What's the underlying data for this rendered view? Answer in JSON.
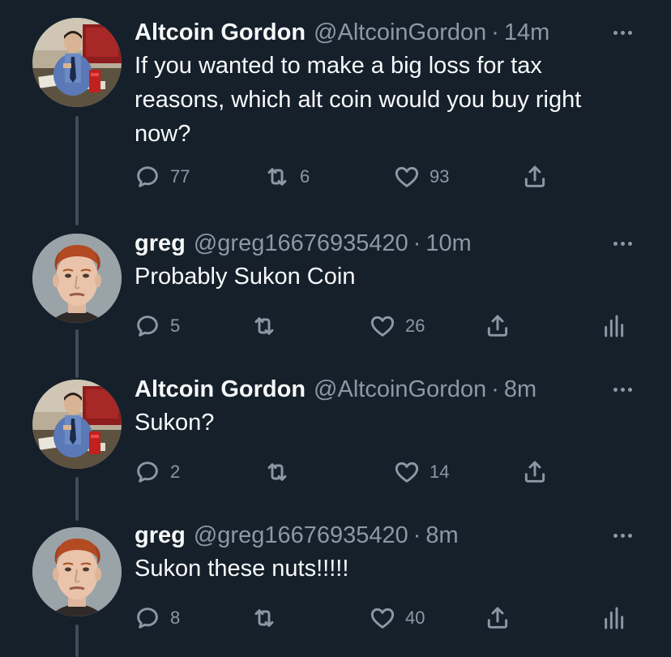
{
  "tweets": [
    {
      "author": "Altcoin Gordon",
      "handle": "@AltcoinGordon",
      "separator": "·",
      "time": "14m",
      "text": "If you wanted to make a big loss for tax reasons, which alt coin would you buy right now?",
      "replies": "77",
      "retweets": "6",
      "likes": "93",
      "avatar": "man-at-desk-avatar"
    },
    {
      "author": "greg",
      "handle": "@greg16676935420",
      "separator": "·",
      "time": "10m",
      "text": "Probably Sukon Coin",
      "replies": "5",
      "retweets": "",
      "likes": "26",
      "avatar": "red-haired-man-avatar"
    },
    {
      "author": "Altcoin Gordon",
      "handle": "@AltcoinGordon",
      "separator": "·",
      "time": "8m",
      "text": "Sukon?",
      "replies": "2",
      "retweets": "",
      "likes": "14",
      "avatar": "man-at-desk-avatar"
    },
    {
      "author": "greg",
      "handle": "@greg16676935420",
      "separator": "·",
      "time": "8m",
      "text": "Sukon these nuts!!!!!",
      "replies": "8",
      "retweets": "",
      "likes": "40",
      "avatar": "red-haired-man-avatar"
    }
  ],
  "colors": {
    "background": "#15202b",
    "primary_text": "#f7f9f9",
    "secondary_text": "#8b98a5",
    "thread_line": "#3e4c5a"
  }
}
